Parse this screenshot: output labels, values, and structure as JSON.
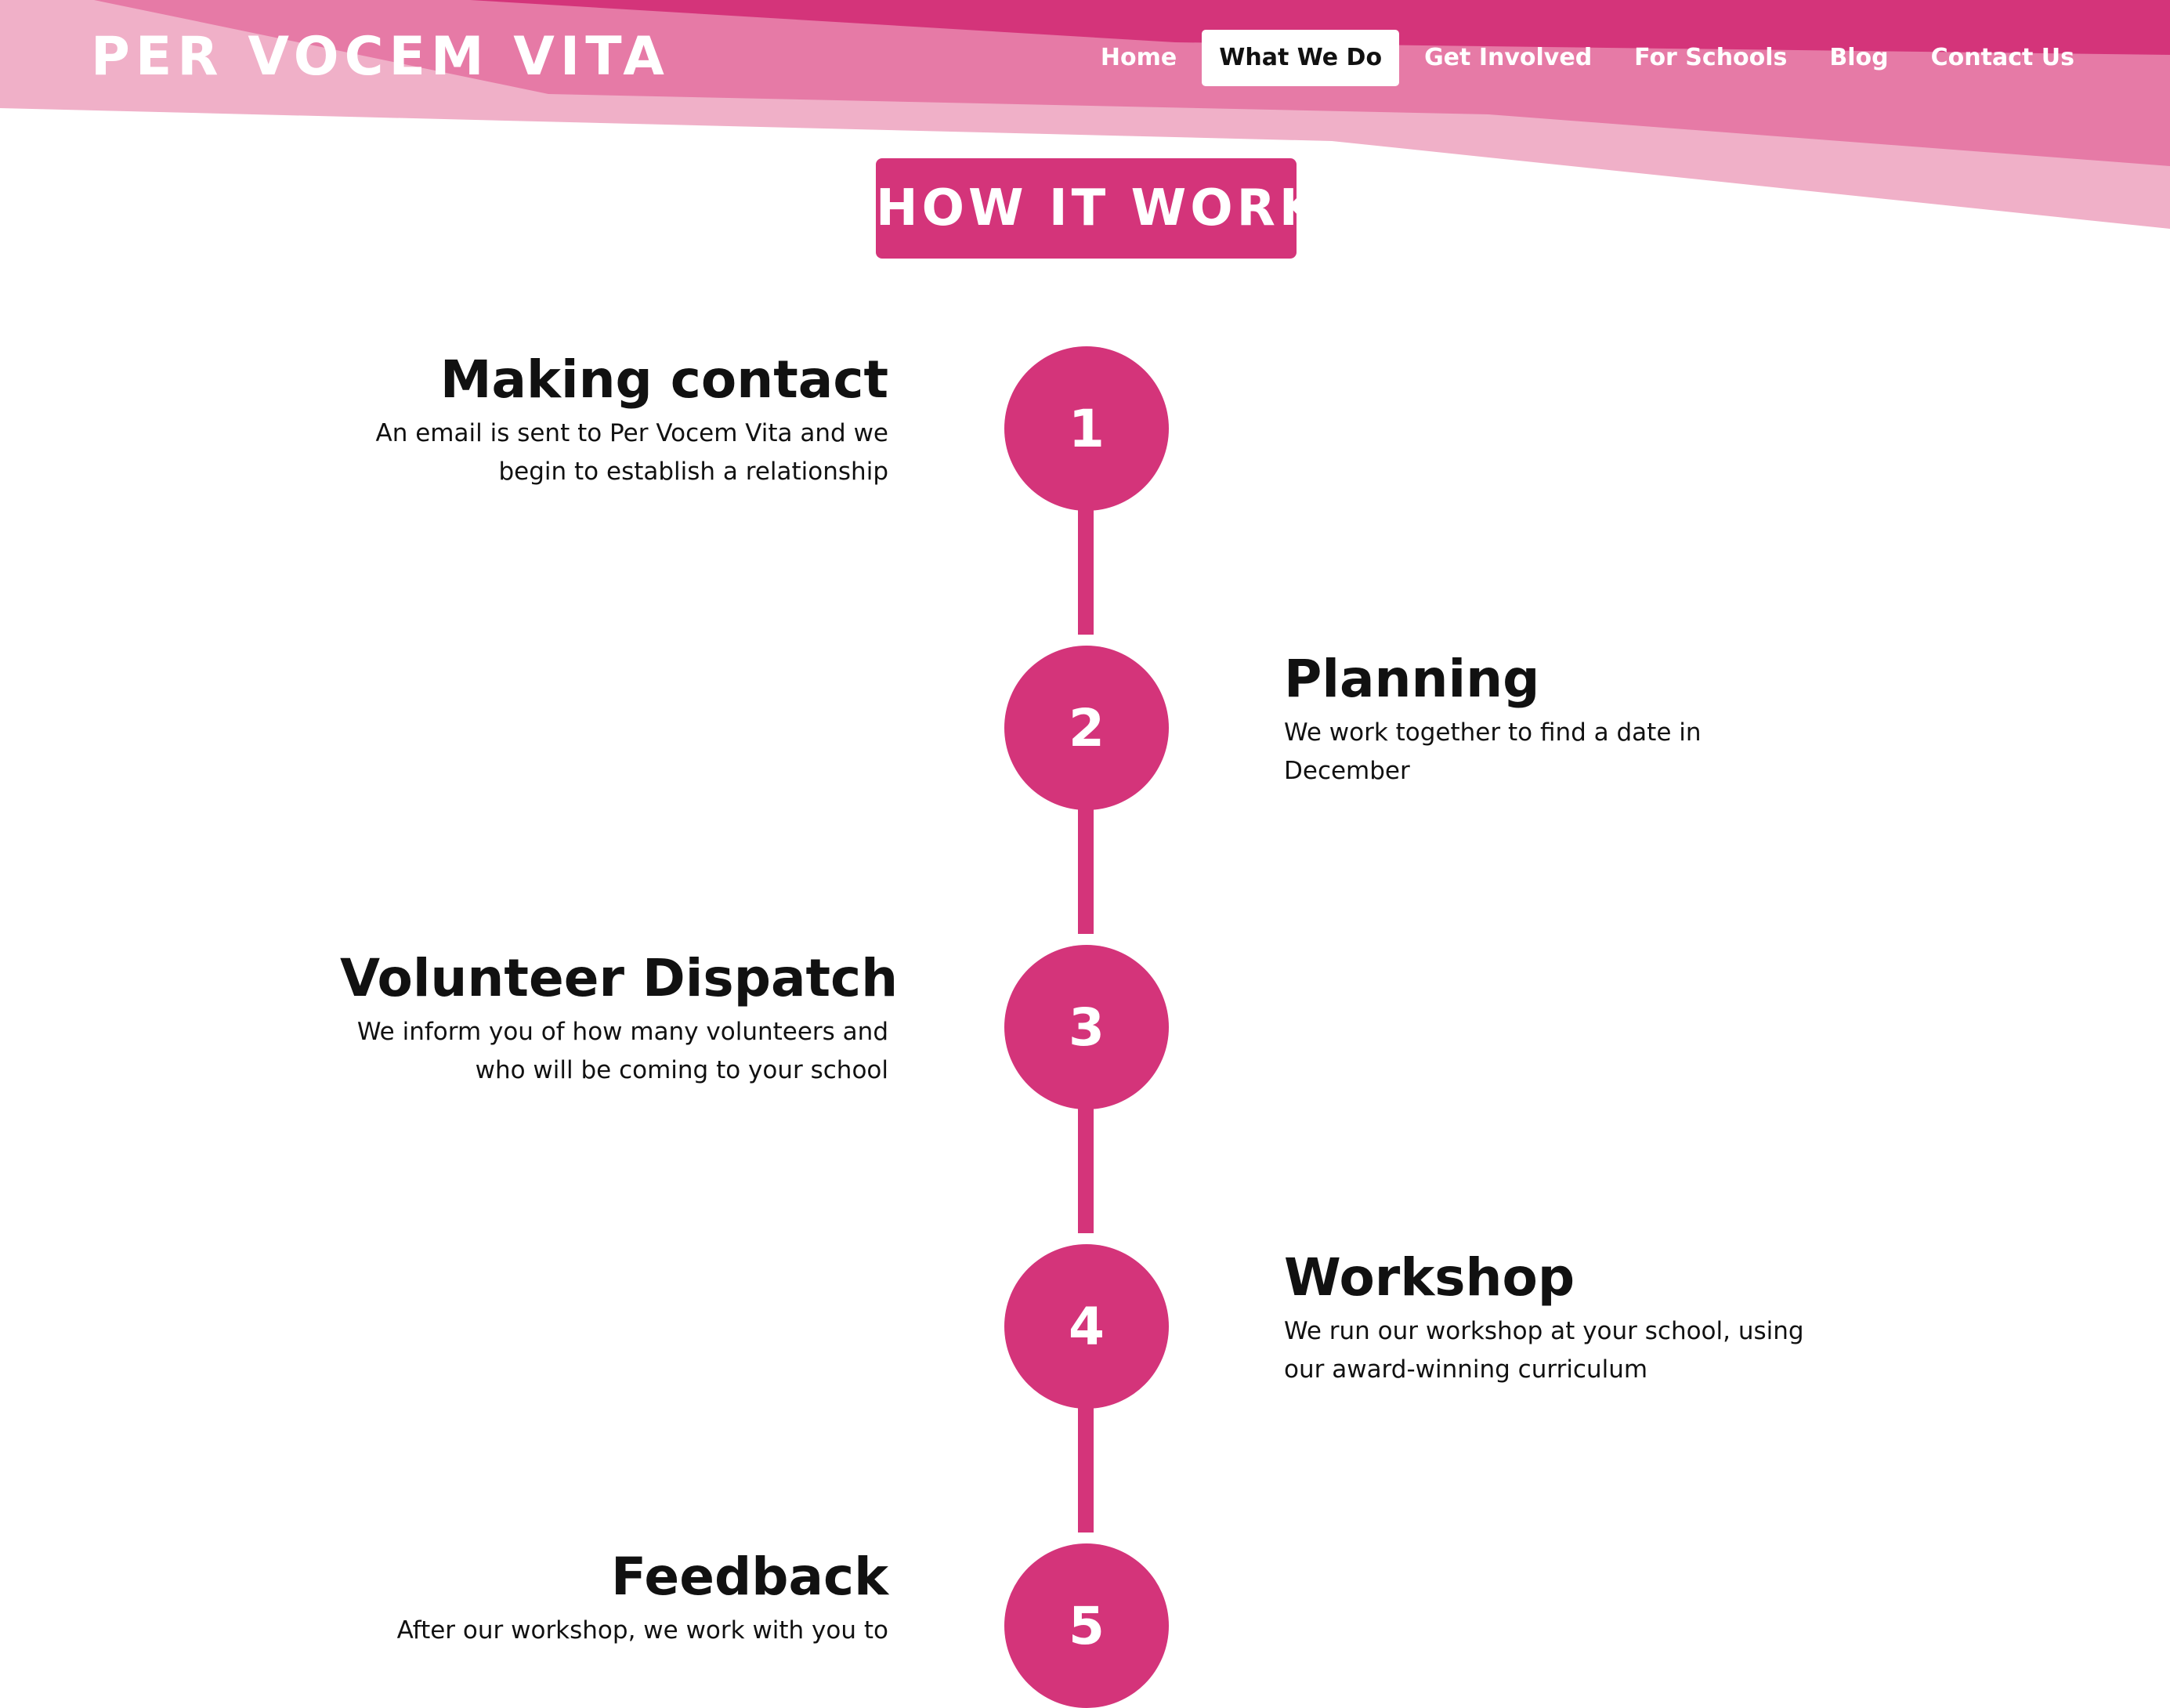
{
  "site": {
    "logo_text": "PER VOCEM VITA"
  },
  "nav": {
    "items": [
      {
        "label": "Home"
      },
      {
        "label": "What We Do"
      },
      {
        "label": "Get Involved"
      },
      {
        "label": "For Schools"
      },
      {
        "label": "Blog"
      },
      {
        "label": "Contact Us"
      }
    ],
    "active": "What We Do"
  },
  "section": {
    "title": "HOW IT WORKS"
  },
  "steps": [
    {
      "number": "1",
      "title": "Making contact",
      "description": "An email is sent to Per Vocem Vita and we begin to establish a relationship",
      "side": "left"
    },
    {
      "number": "2",
      "title": "Planning",
      "description": "We work together to find a date in December",
      "side": "right"
    },
    {
      "number": "3",
      "title": "Volunteer Dispatch",
      "description": "We inform you of how many volunteers and who will be coming to your school",
      "side": "left"
    },
    {
      "number": "4",
      "title": "Workshop",
      "description": "We run our workshop at your school, using our award-winning curriculum",
      "side": "right"
    },
    {
      "number": "5",
      "title": "Feedback",
      "description": "After our workshop, we work with you to",
      "side": "left"
    }
  ],
  "colors": {
    "brand_pink": "#d4347a",
    "light_pink": "#f0b0c8",
    "mid_pink": "#e67aa6",
    "text": "#111111",
    "background": "#ffffff"
  }
}
